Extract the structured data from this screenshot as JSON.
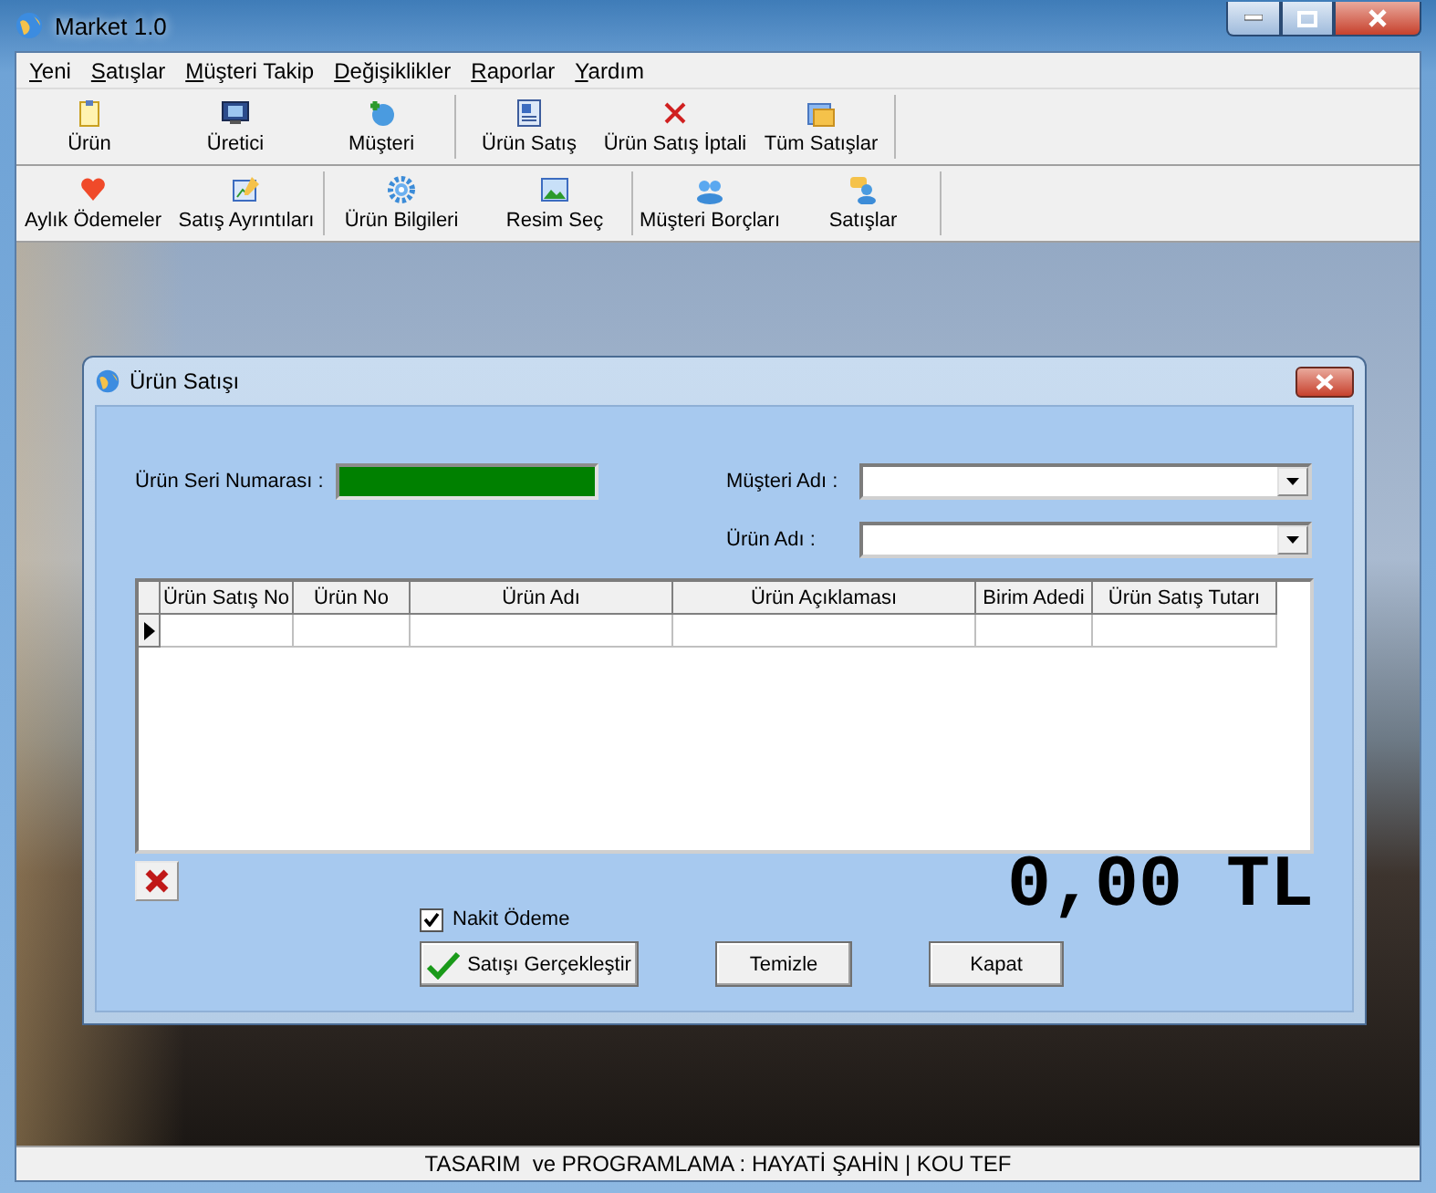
{
  "window": {
    "title": "Market 1.0"
  },
  "menu": [
    {
      "label": "Yeni"
    },
    {
      "label": "Satışlar"
    },
    {
      "label": "Müşteri Takip"
    },
    {
      "label": "Değişiklikler"
    },
    {
      "label": "Raporlar"
    },
    {
      "label": "Yardım"
    }
  ],
  "toolbars": [
    {
      "groups": [
        [
          {
            "label": "Ürün"
          },
          {
            "label": "Üretici"
          },
          {
            "label": "Müşteri"
          }
        ],
        [
          {
            "label": "Ürün Satış"
          },
          {
            "label": "Ürün Satış İptali"
          },
          {
            "label": "Tüm Satışlar"
          }
        ]
      ]
    },
    {
      "groups": [
        [
          {
            "label": "Aylık Ödemeler"
          },
          {
            "label": "Satış Ayrıntıları"
          }
        ],
        [
          {
            "label": "Ürün Bilgileri"
          },
          {
            "label": "Resim Seç"
          }
        ],
        [
          {
            "label": "Müşteri Borçları"
          },
          {
            "label": "Satışlar"
          }
        ]
      ]
    }
  ],
  "dialog": {
    "title": "Ürün Satışı",
    "serial_label": "Ürün Seri Numarası :",
    "customer_label": "Müşteri Adı :",
    "product_label": "Ürün Adı :",
    "table": {
      "columns": [
        "Ürün Satış No",
        "Ürün No",
        "Ürün Adı",
        "Ürün Açıklaması",
        "Birim Adedi",
        "Ürün Satış Tutarı"
      ],
      "rows": [
        {
          "current": true
        }
      ]
    },
    "cash_payment": {
      "label": "Nakit Ödeme",
      "checked": true
    },
    "total": "0,00 TL",
    "buttons": [
      {
        "label": "Satışı Gerçekleştir",
        "kind": "confirm"
      },
      {
        "label": "Temizle",
        "kind": "plain"
      },
      {
        "label": "Kapat",
        "kind": "plain"
      }
    ]
  },
  "status_bar": "TASARIM  ve PROGRAMLAMA : HAYATİ ŞAHİN | KOU TEF"
}
